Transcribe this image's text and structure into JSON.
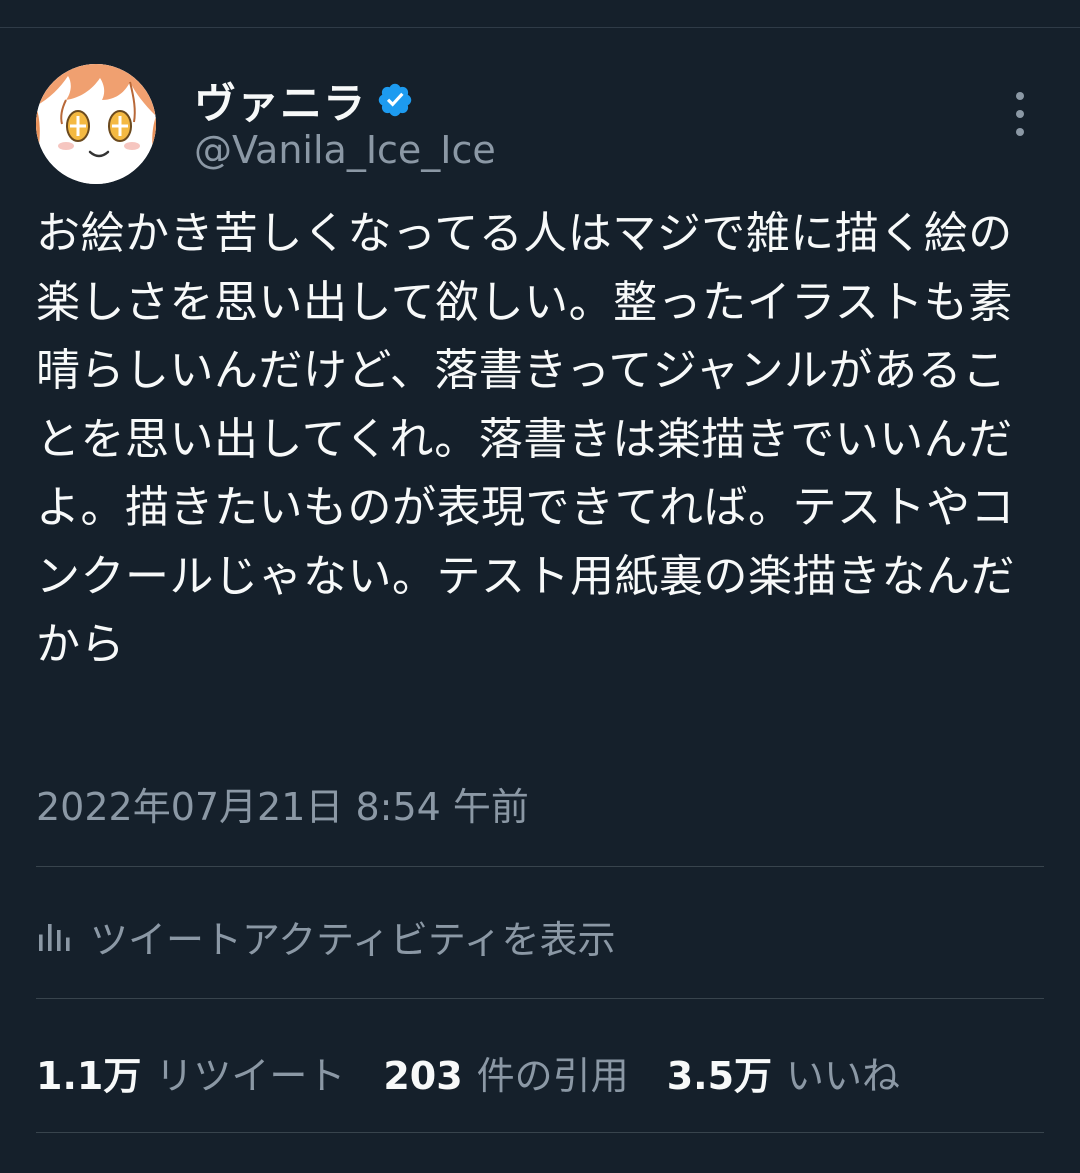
{
  "user": {
    "display_name": "ヴァニラ",
    "handle": "@Vanila_Ice_Ice"
  },
  "tweet": {
    "text": "お絵かき苦しくなってる人はマジで雑に描く絵の楽しさを思い出して欲しい。整ったイラストも素晴らしいんだけど、落書きってジャンルがあることを思い出してくれ。落書きは楽描きでいいんだよ。描きたいものが表現できてれば。テストやコンクールじゃない。テスト用紙裏の楽描きなんだから",
    "timestamp": "2022年07月21日 8:54 午前"
  },
  "activity": {
    "label": "ツイートアクティビティを表示"
  },
  "stats": {
    "retweets_value": "1.1万",
    "retweets_label": "リツイート",
    "quotes_value": "203",
    "quotes_label": "件の引用",
    "likes_value": "3.5万",
    "likes_label": "いいね"
  },
  "colors": {
    "background": "#15202b",
    "text_primary": "#f7f9f9",
    "text_secondary": "#8b98a5",
    "verified": "#1d9bf0",
    "divider": "#38444d"
  },
  "icons": {
    "verified": "verified-badge-icon",
    "more": "more-vertical-icon",
    "activity": "bar-chart-icon"
  }
}
